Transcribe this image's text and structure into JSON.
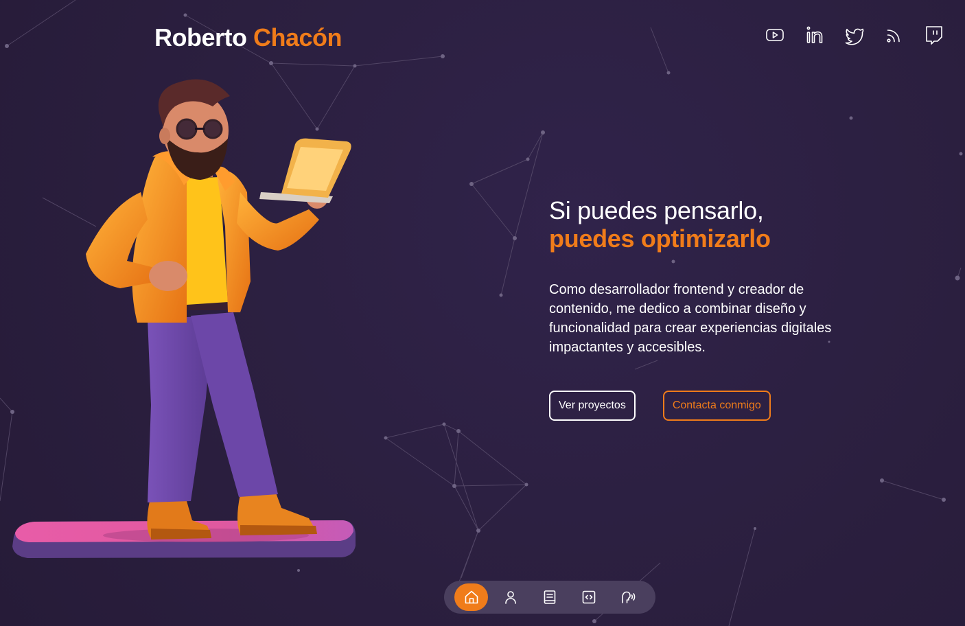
{
  "brand": {
    "first_name": "Roberto",
    "last_name": "Chacón"
  },
  "social": [
    {
      "name": "youtube",
      "icon": "youtube-icon"
    },
    {
      "name": "linkedin",
      "icon": "linkedin-icon"
    },
    {
      "name": "twitter",
      "icon": "twitter-icon"
    },
    {
      "name": "rss",
      "icon": "rss-icon"
    },
    {
      "name": "twitch",
      "icon": "twitch-icon"
    }
  ],
  "hero": {
    "headline_line1": "Si puedes pensarlo,",
    "headline_line2": "puedes optimizarlo",
    "description": "Como desarrollador frontend y creador de contenido, me dedico a combinar diseño y funcionalidad para crear experiencias digitales impactantes y accesibles.",
    "primary_button": "Ver proyectos",
    "secondary_button": "Contacta conmigo"
  },
  "dock": {
    "items": [
      {
        "icon": "home-icon",
        "active": true
      },
      {
        "icon": "user-icon",
        "active": false
      },
      {
        "icon": "book-icon",
        "active": false
      },
      {
        "icon": "code-icon",
        "active": false
      },
      {
        "icon": "speaking-icon",
        "active": false
      }
    ]
  },
  "colors": {
    "background": "#2b1f3f",
    "accent": "#f07c1a",
    "text": "#ffffff",
    "dock": "#4a3f5e"
  }
}
